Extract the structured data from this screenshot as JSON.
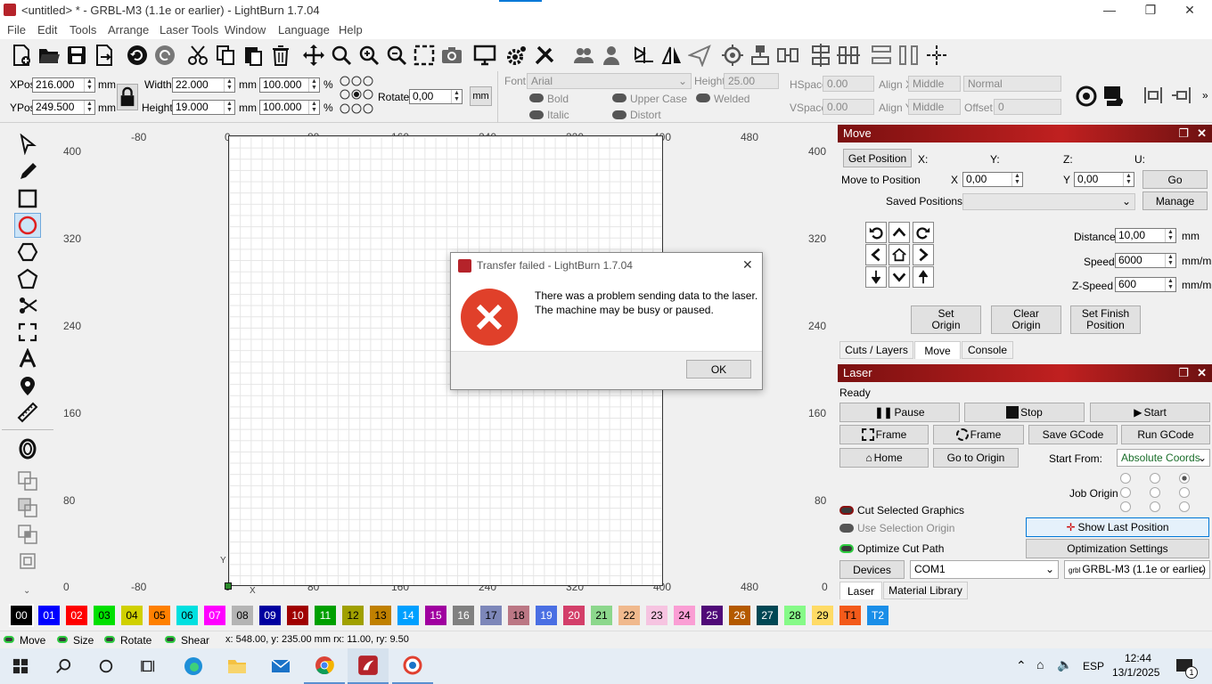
{
  "window": {
    "title": "<untitled> * - GRBL-M3 (1.1e or earlier) - LightBurn 1.7.04",
    "min": "—",
    "max": "❐",
    "close": "✕"
  },
  "menu": [
    "File",
    "Edit",
    "Tools",
    "Arrange",
    "Laser Tools",
    "Window",
    "Language",
    "Help"
  ],
  "props": {
    "xpos_label": "XPos",
    "xpos": "216.000",
    "ypos_label": "YPos",
    "ypos": "249.500",
    "unit_mm": "mm",
    "width_label": "Width",
    "width": "22.000",
    "height_label": "Height",
    "height": "19.000",
    "wpct": "100.000",
    "hpct": "100.000",
    "pct": "%",
    "rotate_label": "Rotate",
    "rotate": "0,00",
    "mm_btn": "mm",
    "font_label": "Font",
    "font": "Arial",
    "fheight_label": "Height",
    "fheight": "25.00",
    "bold": "Bold",
    "italic": "Italic",
    "upper": "Upper Case",
    "distort": "Distort",
    "welded": "Welded",
    "hspace_label": "HSpace",
    "hspace": "0.00",
    "vspace_label": "VSpace",
    "vspace": "0.00",
    "alignx_label": "Align X",
    "alignx": "Middle",
    "aligny_label": "Align Y",
    "aligny": "Middle",
    "normal": "Normal",
    "offset_label": "Offset",
    "offset": "0"
  },
  "ruler": {
    "top": [
      "-80",
      "0",
      "80",
      "160",
      "240",
      "320",
      "400",
      "480"
    ],
    "bottom": [
      "0",
      "-80",
      "0",
      "80",
      "160",
      "240",
      "320",
      "400",
      "480",
      "0"
    ],
    "left": [
      "400",
      "320",
      "240",
      "160",
      "80",
      "0"
    ],
    "right": [
      "400",
      "320",
      "240",
      "160",
      "80"
    ],
    "ylabel": "Y",
    "xlabel": "X"
  },
  "dialog": {
    "title": "Transfer failed - LightBurn 1.7.04",
    "line1": "There was a problem sending data to the laser.",
    "line2": "The machine may be busy or paused.",
    "ok": "OK",
    "close": "✕"
  },
  "move": {
    "title": "Move",
    "get_position": "Get Position",
    "x": "X:",
    "y": "Y:",
    "z": "Z:",
    "u": "U:",
    "move_to": "Move to Position",
    "mx_label": "X",
    "mx": "0,00",
    "my_label": "Y",
    "my": "0,00",
    "go": "Go",
    "saved": "Saved Positions:",
    "manage": "Manage",
    "distance_label": "Distance",
    "distance": "10,00",
    "mm": "mm",
    "speed_label": "Speed",
    "speed": "6000",
    "zspeed_label": "Z-Speed",
    "zspeed": "600",
    "mmm": "mm/m",
    "set_origin": [
      "Set",
      "Origin"
    ],
    "clear_origin": [
      "Clear",
      "Origin"
    ],
    "set_finish": [
      "Set Finish",
      "Position"
    ]
  },
  "tabs_top": [
    "Cuts / Layers",
    "Move",
    "Console"
  ],
  "laser": {
    "title": "Laser",
    "status": "Ready",
    "pause": "Pause",
    "stop": "Stop",
    "start": "Start",
    "frame1": "Frame",
    "frame2": "Frame",
    "save_gcode": "Save GCode",
    "run_gcode": "Run GCode",
    "home": "Home",
    "go_origin": "Go to Origin",
    "start_from": "Start From:",
    "start_from_val": "Absolute Coords",
    "job_origin": "Job Origin",
    "cut_selected": "Cut Selected Graphics",
    "use_selection": "Use Selection Origin",
    "show_last": "Show Last Position",
    "optimize": "Optimize Cut Path",
    "opt_settings": "Optimization Settings",
    "devices": "Devices",
    "com": "COM1",
    "device": "GRBL-M3 (1.1e or earlier)",
    "grbl": "grbl"
  },
  "tabs_bottom": [
    "Laser",
    "Material Library"
  ],
  "palette": [
    {
      "l": "00",
      "c": "#000000",
      "t": "#ffffff"
    },
    {
      "l": "01",
      "c": "#0000ff",
      "t": "#ffffff"
    },
    {
      "l": "02",
      "c": "#ff0000",
      "t": "#ffffff"
    },
    {
      "l": "03",
      "c": "#00e000",
      "t": "#000000"
    },
    {
      "l": "04",
      "c": "#d0d000",
      "t": "#000000"
    },
    {
      "l": "05",
      "c": "#ff8000",
      "t": "#000000"
    },
    {
      "l": "06",
      "c": "#00e0e0",
      "t": "#000000"
    },
    {
      "l": "07",
      "c": "#ff00ff",
      "t": "#ffffff"
    },
    {
      "l": "08",
      "c": "#b4b4b4",
      "t": "#000000"
    },
    {
      "l": "09",
      "c": "#0000a0",
      "t": "#ffffff"
    },
    {
      "l": "10",
      "c": "#a00000",
      "t": "#ffffff"
    },
    {
      "l": "11",
      "c": "#00a000",
      "t": "#ffffff"
    },
    {
      "l": "12",
      "c": "#a0a000",
      "t": "#000000"
    },
    {
      "l": "13",
      "c": "#c08000",
      "t": "#000000"
    },
    {
      "l": "14",
      "c": "#00a0ff",
      "t": "#ffffff"
    },
    {
      "l": "15",
      "c": "#a000a0",
      "t": "#ffffff"
    },
    {
      "l": "16",
      "c": "#808080",
      "t": "#ffffff"
    },
    {
      "l": "17",
      "c": "#7d87b9",
      "t": "#000000"
    },
    {
      "l": "18",
      "c": "#bb7784",
      "t": "#000000"
    },
    {
      "l": "19",
      "c": "#4a6fe3",
      "t": "#ffffff"
    },
    {
      "l": "20",
      "c": "#d33f6a",
      "t": "#ffffff"
    },
    {
      "l": "21",
      "c": "#8cd78c",
      "t": "#000000"
    },
    {
      "l": "22",
      "c": "#f0b98d",
      "t": "#000000"
    },
    {
      "l": "23",
      "c": "#f6c4e1",
      "t": "#000000"
    },
    {
      "l": "24",
      "c": "#fa9ed4",
      "t": "#000000"
    },
    {
      "l": "25",
      "c": "#500a78",
      "t": "#ffffff"
    },
    {
      "l": "26",
      "c": "#b45a00",
      "t": "#ffffff"
    },
    {
      "l": "27",
      "c": "#004754",
      "t": "#ffffff"
    },
    {
      "l": "28",
      "c": "#86fa88",
      "t": "#000000"
    },
    {
      "l": "29",
      "c": "#ffdb66",
      "t": "#000000"
    },
    {
      "l": "T1",
      "c": "#f35a1a",
      "t": "#000000"
    },
    {
      "l": "T2",
      "c": "#1a8ee8",
      "t": "#ffffff"
    }
  ],
  "status": {
    "move": "Move",
    "size": "Size",
    "rotate": "Rotate",
    "shear": "Shear",
    "coords": "x: 548.00, y: 235.00 mm  rx: 11.00, ry: 9.50"
  },
  "taskbar": {
    "lang": "ESP",
    "time": "12:44",
    "date": "13/1/2025",
    "notif": "1"
  }
}
